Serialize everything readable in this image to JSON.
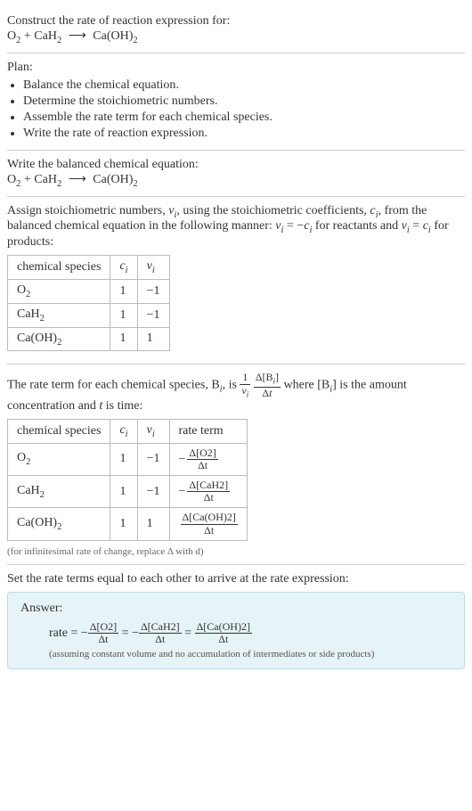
{
  "intro": {
    "prompt": "Construct the rate of reaction expression for:",
    "equation_reactant1": "O",
    "equation_reactant1_sub": "2",
    "equation_plus": " + ",
    "equation_reactant2": "CaH",
    "equation_reactant2_sub": "2",
    "equation_arrow": "⟶",
    "equation_product": "Ca(OH)",
    "equation_product_sub": "2"
  },
  "plan": {
    "title": "Plan:",
    "items": [
      "Balance the chemical equation.",
      "Determine the stoichiometric numbers.",
      "Assemble the rate term for each chemical species.",
      "Write the rate of reaction expression."
    ]
  },
  "balanced": {
    "title": "Write the balanced chemical equation:"
  },
  "assign": {
    "text_a": "Assign stoichiometric numbers, ",
    "nu_i": "ν",
    "sub_i": "i",
    "text_b": ", using the stoichiometric coefficients, ",
    "c_i": "c",
    "text_c": ", from the balanced chemical equation in the following manner: ",
    "eq1_lhs": "ν",
    "eq1_eq": " = −",
    "eq1_rhs": "c",
    "text_d": " for reactants and ",
    "eq2_lhs": "ν",
    "eq2_eq": " = ",
    "eq2_rhs": "c",
    "text_e": " for products:",
    "headers": [
      "chemical species",
      "c",
      "ν"
    ],
    "header_sub": "i",
    "rows": [
      {
        "species": "O",
        "species_sub": "2",
        "c": "1",
        "nu": "−1"
      },
      {
        "species": "CaH",
        "species_sub": "2",
        "c": "1",
        "nu": "−1"
      },
      {
        "species": "Ca(OH)",
        "species_sub": "2",
        "c": "1",
        "nu": "1"
      }
    ]
  },
  "rateterm": {
    "text_a": "The rate term for each chemical species, B",
    "sub_i": "i",
    "text_b": ", is ",
    "frac1_num": "1",
    "frac1_den_a": "ν",
    "frac2_num_a": "Δ[B",
    "frac2_num_b": "]",
    "frac2_den": "Δt",
    "text_c": " where [B",
    "text_d": "] is the amount concentration and ",
    "t": "t",
    "text_e": " is time:",
    "headers": [
      "chemical species",
      "c",
      "ν",
      "rate term"
    ],
    "header_sub": "i",
    "rows": [
      {
        "species": "O",
        "species_sub": "2",
        "c": "1",
        "nu": "−1",
        "neg": "−",
        "num": "Δ[O2]",
        "den": "Δt"
      },
      {
        "species": "CaH",
        "species_sub": "2",
        "c": "1",
        "nu": "−1",
        "neg": "−",
        "num": "Δ[CaH2]",
        "den": "Δt"
      },
      {
        "species": "Ca(OH)",
        "species_sub": "2",
        "c": "1",
        "nu": "1",
        "neg": "",
        "num": "Δ[Ca(OH)2]",
        "den": "Δt"
      }
    ],
    "note": "(for infinitesimal rate of change, replace Δ with d)"
  },
  "final": {
    "title": "Set the rate terms equal to each other to arrive at the rate expression:",
    "answer_label": "Answer:",
    "rate_label": "rate = ",
    "neg": "−",
    "t1_num": "Δ[O2]",
    "t1_den": "Δt",
    "eq": " = ",
    "t2_num": "Δ[CaH2]",
    "t2_den": "Δt",
    "t3_num": "Δ[Ca(OH)2]",
    "t3_den": "Δt",
    "note": "(assuming constant volume and no accumulation of intermediates or side products)"
  }
}
